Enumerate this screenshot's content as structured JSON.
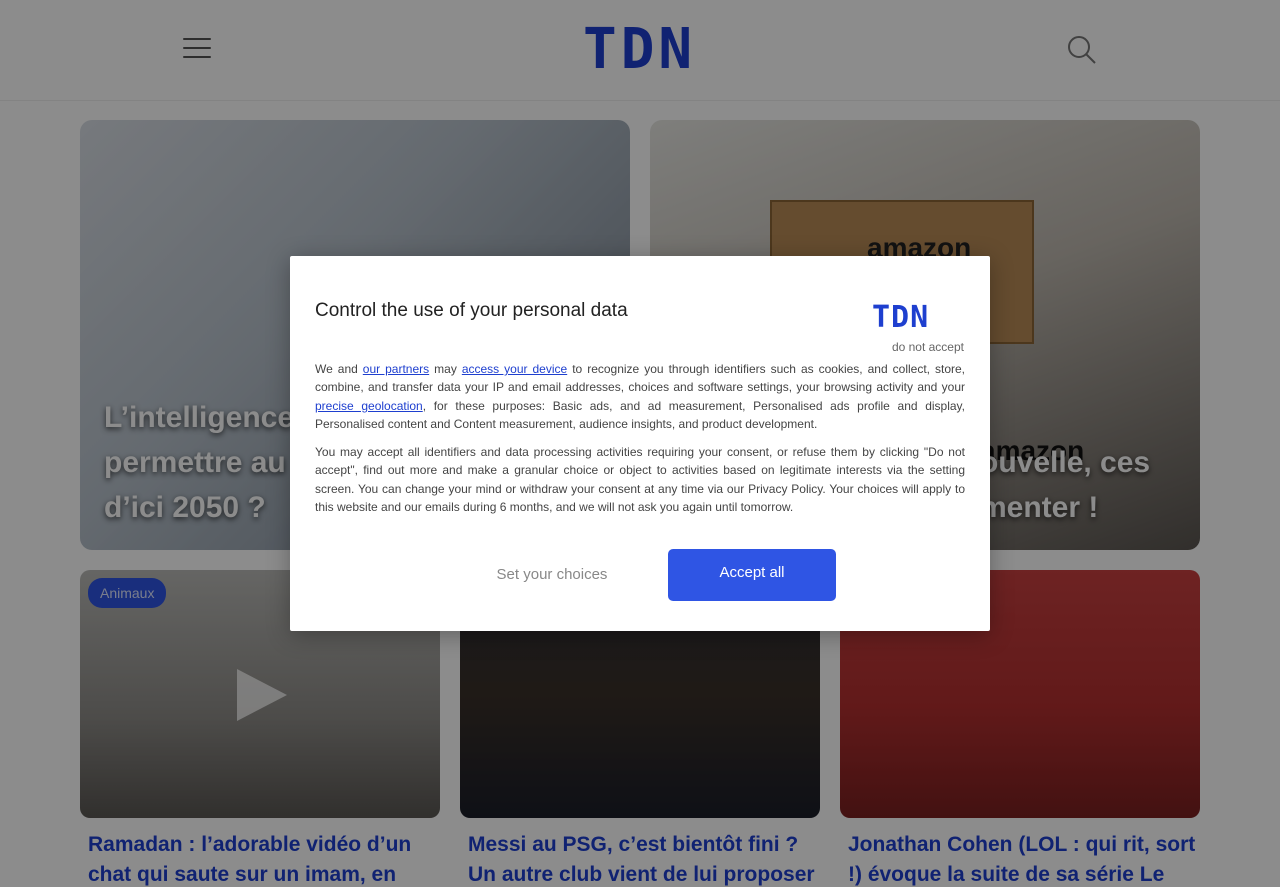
{
  "header": {
    "logo": "TDN",
    "menu_icon": "hamburger-menu-icon",
    "search_icon": "search-icon"
  },
  "featured": [
    {
      "title_lines": [
        "L’intelligence",
        "permettre au",
        "d’ici 2050 ?"
      ]
    },
    {
      "title_lines": [
        "ouvelle, ces",
        "menter !"
      ],
      "box_label_1": "amazon",
      "box_label_2": "amazon"
    }
  ],
  "articles": [
    {
      "category": "Animaux",
      "title_lines": [
        "Ramadan : l’adorable vidéo d’un",
        "chat qui saute sur un imam, en"
      ]
    },
    {
      "category": "",
      "title_lines": [
        "Messi au PSG, c’est bientôt fini ?",
        "Un autre club vient de lui proposer"
      ]
    },
    {
      "category": "",
      "title_lines": [
        "Jonathan Cohen (LOL : qui rit, sort",
        "!) évoque la suite de sa série Le"
      ]
    }
  ],
  "consent": {
    "title": "Control the use of your personal data",
    "logo": "TDN",
    "do_not_accept": "do not accept",
    "p1_a": "We and ",
    "link_partners": "our partners",
    "p1_b": " may ",
    "link_device": "access your device",
    "p1_c": " to recognize you through identifiers such as cookies, and collect, store, combine, and transfer data your IP and email addresses, choices and software settings, your browsing activity and your ",
    "link_geo": "precise geolocation",
    "p1_d": ", for these purposes: Basic ads, and ad measurement, Personalised ads profile and display, Personalised content and Content measurement, audience insights, and product development.",
    "p2": "You may accept all identifiers and data processing activities requiring your consent, or refuse them by clicking \"Do not accept\", find out more and make a granular choice or object to activities based on legitimate interests via the setting screen. You can change your mind or withdraw your consent at any time via our Privacy Policy. Your choices will apply to this website and our emails during 6 months, and we will not ask you again until tomorrow.",
    "set_choices": "Set your choices",
    "accept_all": "Accept all"
  },
  "colors": {
    "brand": "#1e3fcf",
    "accent_button": "#2f55e4"
  }
}
